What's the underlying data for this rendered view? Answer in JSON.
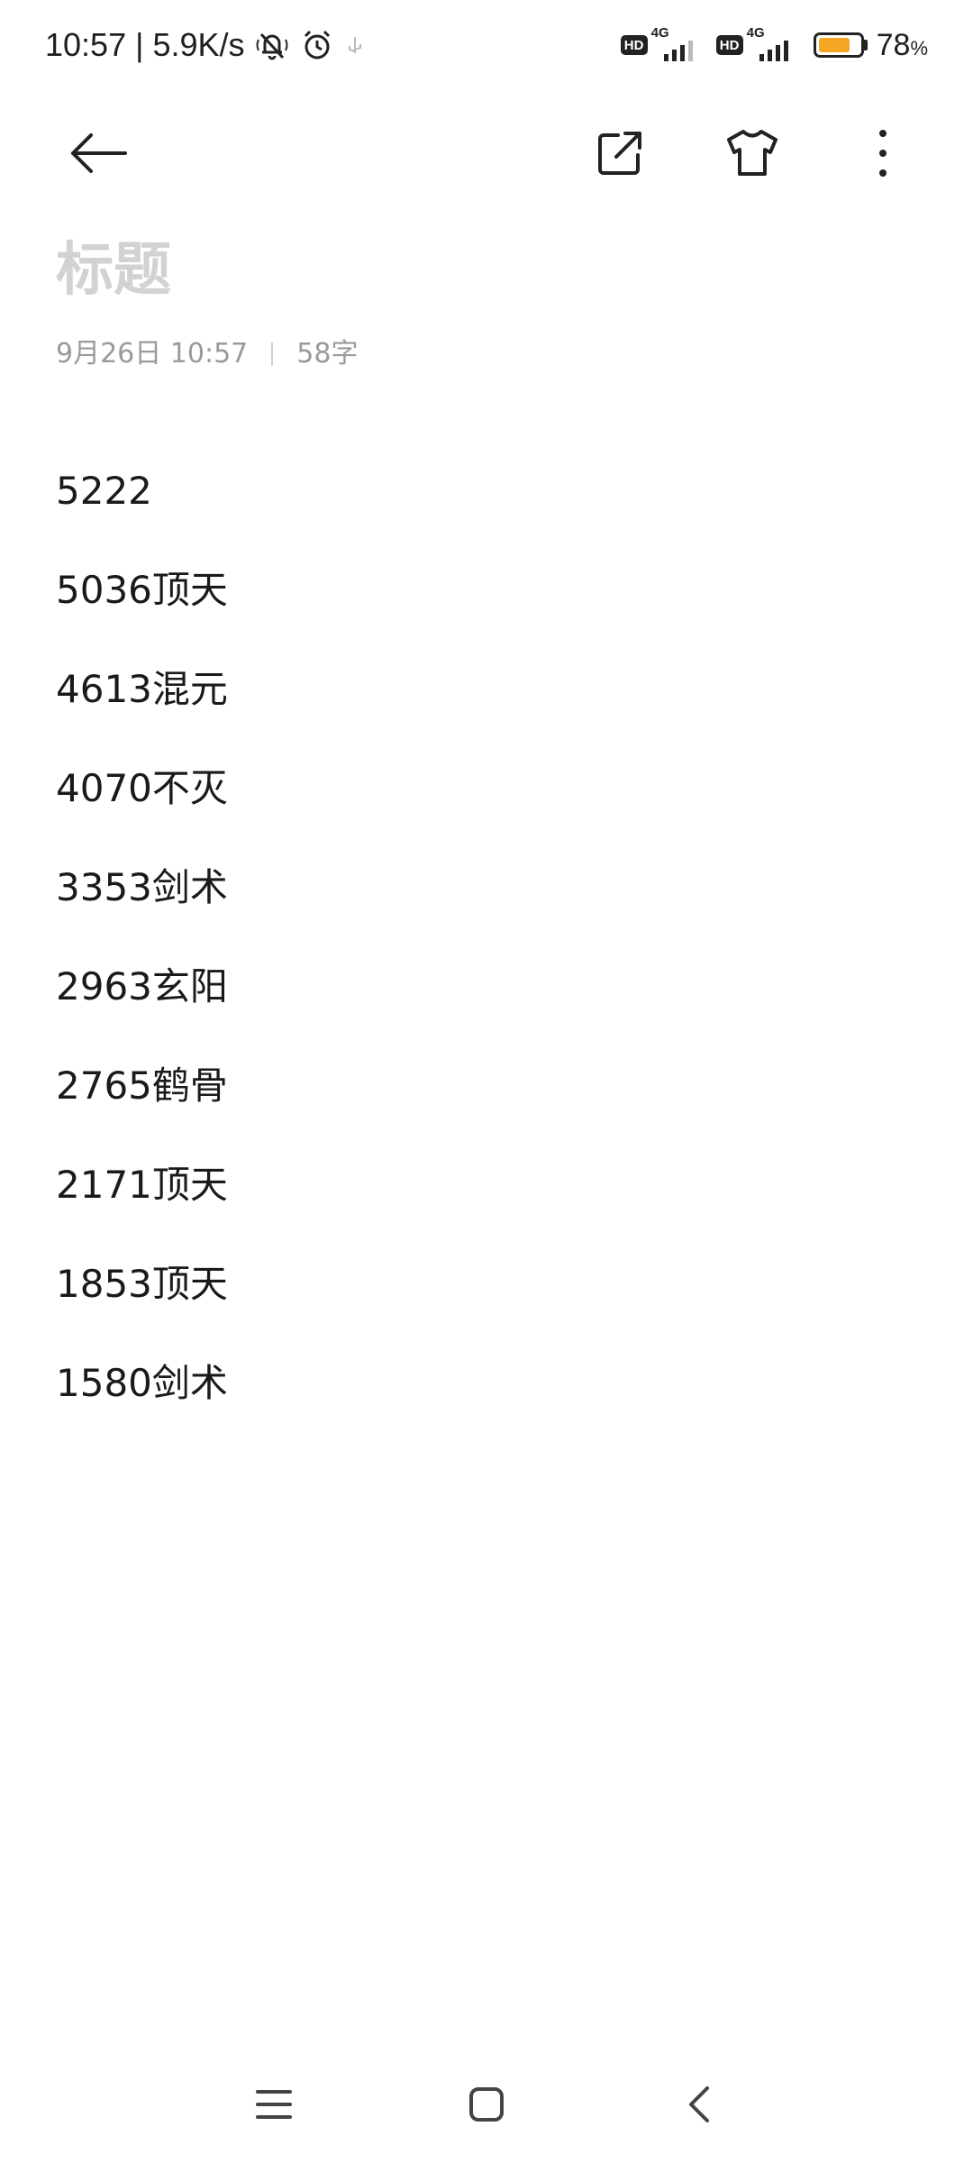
{
  "status_bar": {
    "time": "10:57",
    "separator": "|",
    "network_speed": "5.9K/s",
    "icons": [
      "bell-off-icon",
      "alarm-icon",
      "usb-icon"
    ],
    "sim1_network": "4G",
    "sim2_network": "4G",
    "hd_label": "HD",
    "battery_level": 0.78,
    "battery_value": "78",
    "battery_unit": "%",
    "battery_color": "#f5a623"
  },
  "toolbar": {
    "icons": [
      "back-arrow-icon",
      "share-icon",
      "theme-shirt-icon",
      "more-vertical-icon"
    ]
  },
  "note": {
    "title_placeholder": "标题",
    "date": "9月26日 10:57",
    "char_count": "58字",
    "lines": [
      "5222",
      "5036顶天",
      "4613混元",
      "4070不灭",
      "3353剑术",
      "2963玄阳",
      "2765鹤骨",
      "2171顶天",
      "1853顶天",
      "1580剑术"
    ]
  },
  "nav_bar": {
    "icons": [
      "menu-icon",
      "home-icon",
      "back-icon"
    ]
  }
}
